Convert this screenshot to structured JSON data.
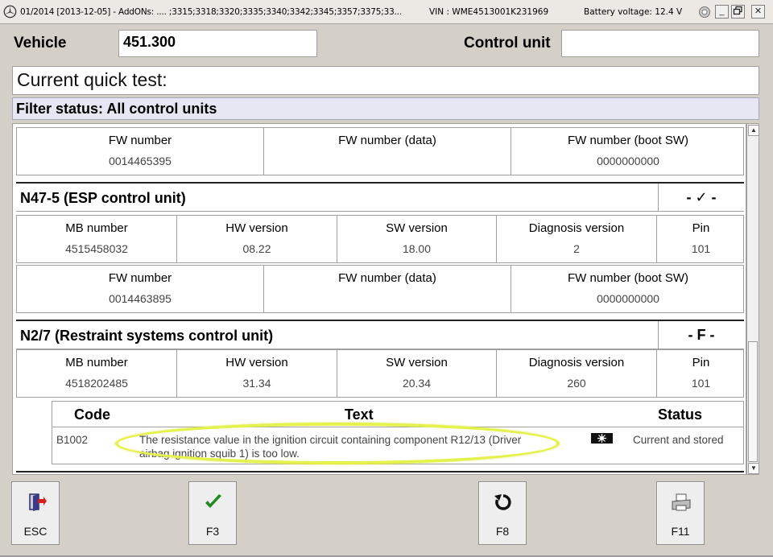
{
  "titlebar": {
    "prefix": "01/2014 [2013-12-05] - AddONs:  .... ;3315;3318;3320;3335;3340;3342;3345;3357;3375;33...",
    "vin": "VIN : WME4513001K231969",
    "battery": "Battery voltage: 12.4 V",
    "minimize": "_",
    "restore": "🗗",
    "close": "✕"
  },
  "vehicle": {
    "label": "Vehicle",
    "value": "451.300"
  },
  "control_unit": {
    "label": "Control unit",
    "value": ""
  },
  "quick_test": {
    "label": "Current quick test:"
  },
  "filter": {
    "label": "Filter status: All control units"
  },
  "top_fw_table": {
    "headers": [
      "FW number",
      "FW number (data)",
      "FW number (boot SW)"
    ],
    "values": [
      "0014465395",
      "",
      "0000000000"
    ]
  },
  "units": [
    {
      "name": "N47-5 (ESP control unit)",
      "status": "- ✓ -",
      "headers": [
        "MB number",
        "HW version",
        "SW version",
        "Diagnosis version",
        "Pin"
      ],
      "values": [
        "4515458032",
        "08.22",
        "18.00",
        "2",
        "101"
      ],
      "fw_headers": [
        "FW number",
        "FW number (data)",
        "FW number (boot SW)"
      ],
      "fw_values": [
        "0014463895",
        "",
        "0000000000"
      ]
    },
    {
      "name": "N2/7 (Restraint systems control unit)",
      "status": "- F -",
      "headers": [
        "MB number",
        "HW version",
        "SW version",
        "Diagnosis version",
        "Pin"
      ],
      "values": [
        "4518202485",
        "31.34",
        "20.34",
        "260",
        "101"
      ]
    }
  ],
  "fault_table": {
    "headers": {
      "code": "Code",
      "text": "Text",
      "status": "Status"
    },
    "rows": [
      {
        "code": "B1002",
        "text_line1": "The resistance value in the ignition circuit containing component R12/13 (Driver",
        "text_line2": "airbag ignition squib 1) is too low.",
        "status": "Current and stored"
      }
    ]
  },
  "function_keys": [
    {
      "label": "ESC",
      "icon": "exit-door-icon"
    },
    {
      "label": "F3",
      "icon": "checkmark-icon"
    },
    {
      "label": "F8",
      "icon": "refresh-icon"
    },
    {
      "label": "F11",
      "icon": "printer-icon"
    }
  ],
  "colors": {
    "highlight": "#e6f24c",
    "filter_bg": "#e7e7f3",
    "window_bg": "#d4d0c8",
    "check_green": "#1f8a1f"
  }
}
